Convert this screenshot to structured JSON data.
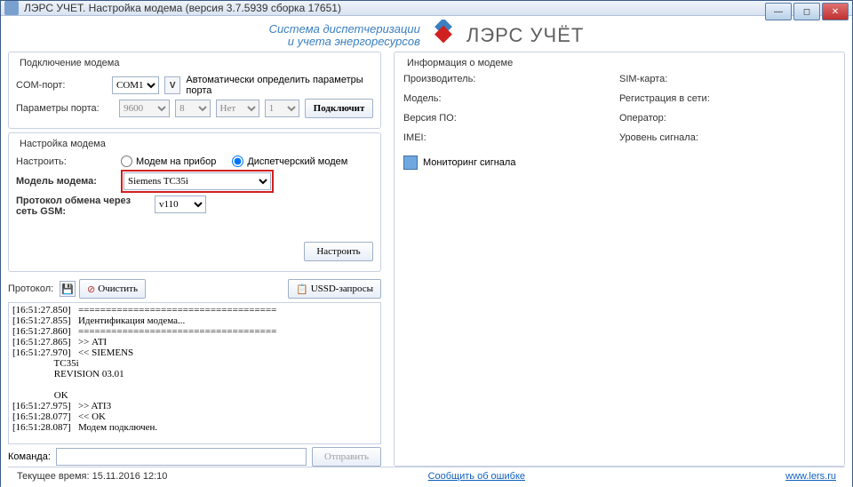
{
  "window": {
    "title": "ЛЭРС УЧЕТ. Настройка модема (версия 3.7.5939 сборка 17651)"
  },
  "banner": {
    "line1": "Система диспетчеризации",
    "line2": "и учета энергоресурсов",
    "brand": "ЛЭРС УЧЁТ"
  },
  "connection": {
    "group_title": "Подключение модема",
    "com_label": "COM-порт:",
    "com_value": "COM1",
    "v_hint": "V",
    "auto_text": "Автоматически определить параметры порта",
    "params_label": "Параметры порта:",
    "baud": "9600",
    "databits": "8",
    "parity": "Нет",
    "stopbits": "1",
    "connect_btn": "Подключит"
  },
  "setup": {
    "group_title": "Настройка модема",
    "configure_label": "Настроить:",
    "radio_device": "Модем на прибор",
    "radio_dispatch": "Диспетчерский модем",
    "model_label": "Модель модема:",
    "model_value": "Siemens TC35i",
    "proto_label": "Протокол обмена через сеть GSM:",
    "proto_value": "v110",
    "setup_btn": "Настроить"
  },
  "protocol": {
    "label": "Протокол:",
    "clear_btn": "Очистить",
    "ussd_btn": "USSD-запросы",
    "log": "[16:51:27.850]   ====================================\n[16:51:27.855]   Идентификация модема...\n[16:51:27.860]   ====================================\n[16:51:27.865]   >> ATI\n[16:51:27.970]   << SIEMENS\n                 TC35i\n                 REVISION 03.01\n\n                 OK\n[16:51:27.975]   >> ATI3\n[16:51:28.077]   << OK\n[16:51:28.087]   Модем подключен.",
    "cmd_label": "Команда:",
    "send_btn": "Отправить"
  },
  "info": {
    "group_title": "Информация о модеме",
    "manufacturer": "Производитель:",
    "simcard": "SIM-карта:",
    "model": "Модель:",
    "netreg": "Регистрация в сети:",
    "version": "Версия ПО:",
    "operator": "Оператор:",
    "imei": "IMEI:",
    "signal": "Уровень сигнала:",
    "monitor": "Мониторинг сигнала"
  },
  "status": {
    "time_label": "Текущее время:",
    "time_value": "15.11.2016 12:10",
    "bug_link": "Сообщить об ошибке",
    "site_link": "www.lers.ru"
  }
}
